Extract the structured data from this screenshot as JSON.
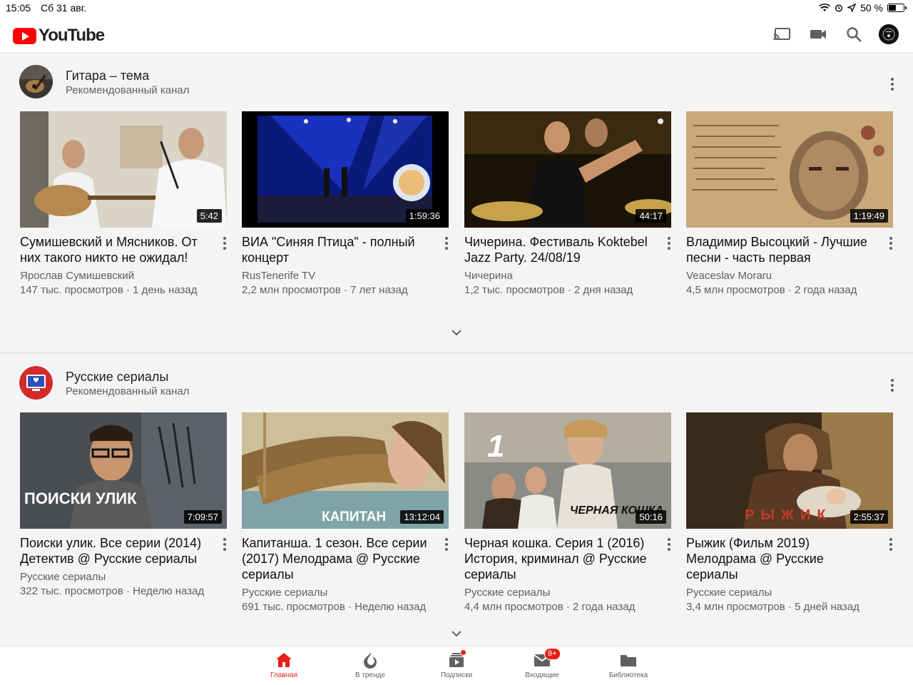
{
  "status": {
    "time": "15:05",
    "date": "Сб 31 авг.",
    "battery": "50 %",
    "battery_level": 0.5
  },
  "header": {
    "logo_text": "YouTube",
    "brand_color": "#ff0000",
    "icons": [
      "cast-icon",
      "video-camera-icon",
      "search-icon",
      "account-avatar"
    ]
  },
  "shelves": [
    {
      "title": "Гитара – тема",
      "subtitle": "Рекомендованный канал",
      "videos": [
        {
          "title": "Сумишевский и Мясников. От них такого никто не ожидал!",
          "channel": "Ярослав Сумишевский",
          "stats": "147 тыс. просмотров · 1 день назад",
          "duration": "5:42"
        },
        {
          "title": "ВИА \"Синяя Птица\" - полный концерт",
          "channel": "RusTenerife TV",
          "stats": "2,2 млн просмотров · 7 лет назад",
          "duration": "1:59:36"
        },
        {
          "title": "Чичерина. Фестиваль Koktebel Jazz Party. 24/08/19",
          "channel": "Чичерина",
          "stats": "1,2 тыс. просмотров · 2 дня назад",
          "duration": "44:17"
        },
        {
          "title": "Владимир Высоцкий - Лучшие песни - часть первая",
          "channel": "Veaceslav Moraru",
          "stats": "4,5 млн просмотров · 2 года назад",
          "duration": "1:19:49"
        }
      ]
    },
    {
      "title": "Русские сериалы",
      "subtitle": "Рекомендованный канал",
      "videos": [
        {
          "title": "Поиски улик. Все серии (2014) Детектив @ Русские сериалы",
          "channel": "Русские сериалы",
          "stats": "322 тыс. просмотров · Неделю назад",
          "duration": "7:09:57",
          "overlay": "ПОИСКИ УЛИК"
        },
        {
          "title": "Капитанша. 1 сезон. Все серии (2017) Мелодрама @ Русские сериалы",
          "channel": "Русские сериалы",
          "stats": "691 тыс. просмотров · Неделю назад",
          "duration": "13:12:04",
          "overlay": "КАПИТАН"
        },
        {
          "title": "Черная кошка. Серия 1 (2016) История, криминал @ Русские сериалы",
          "channel": "Русские сериалы",
          "stats": "4,4 млн просмотров · 2 года назад",
          "duration": "50:16",
          "overlay": "1",
          "overlay2": "ЧЕРНАЯ КОШКА"
        },
        {
          "title": "Рыжик (Фильм 2019) Мелодрама @ Русские сериалы",
          "channel": "Русские сериалы",
          "stats": "3,4 млн просмотров · 5 дней назад",
          "duration": "2:55:37",
          "overlay": "РЫЖИК"
        }
      ]
    }
  ],
  "bottom_nav": [
    {
      "label": "Главная",
      "icon": "home-icon",
      "active": true
    },
    {
      "label": "В тренде",
      "icon": "flame-icon",
      "active": false
    },
    {
      "label": "Подписки",
      "icon": "subscriptions-icon",
      "active": false
    },
    {
      "label": "Входящие",
      "icon": "inbox-icon",
      "active": false,
      "badge": "9+"
    },
    {
      "label": "Библиотека",
      "icon": "library-folder-icon",
      "active": false
    }
  ]
}
